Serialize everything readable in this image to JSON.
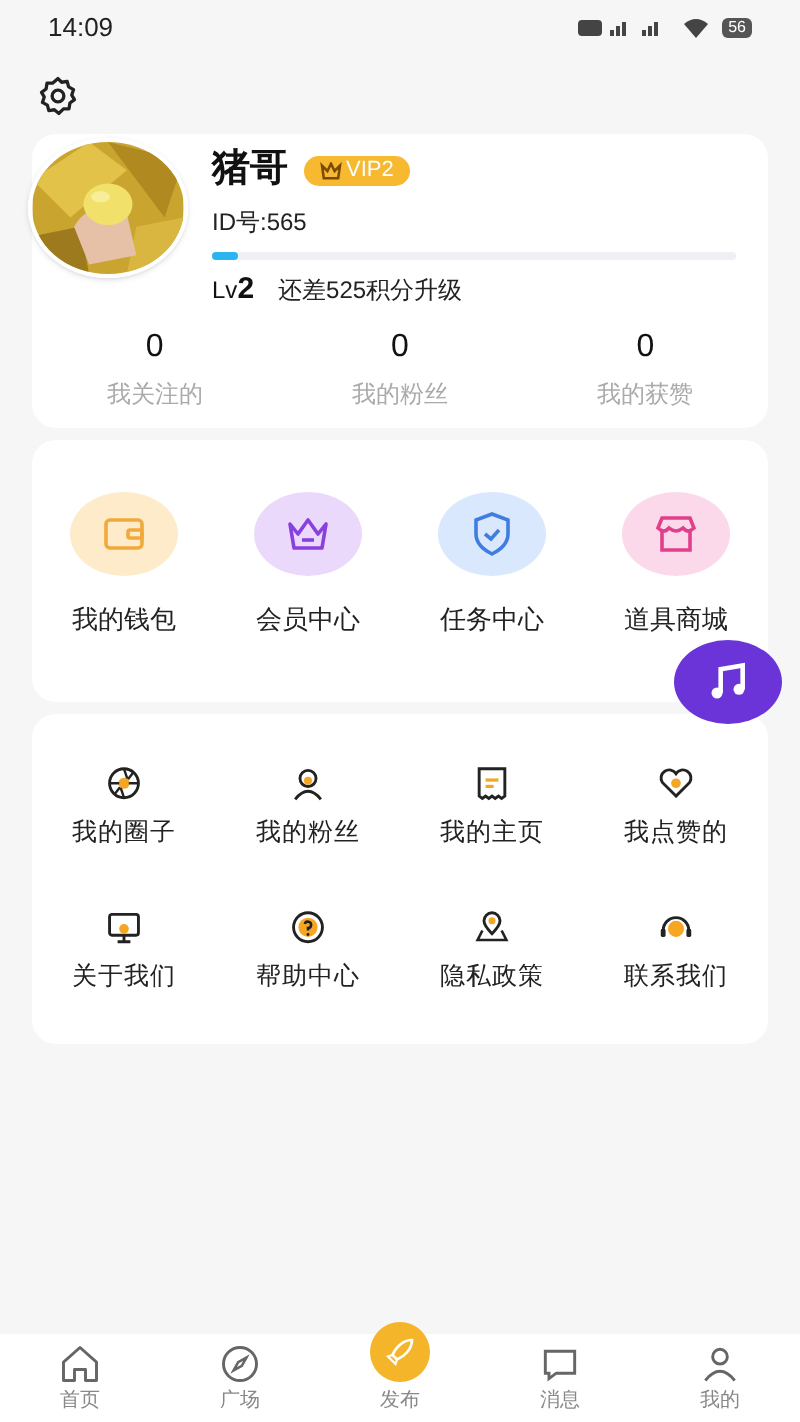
{
  "status_bar": {
    "time": "14:09",
    "battery": "56"
  },
  "profile": {
    "name": "猪哥",
    "vip": "VIP2",
    "id": "ID号:565",
    "level_label": "Lv",
    "level": "2",
    "progress": {
      "level": 0.05
    },
    "upgrade_hint": "还差525积分升级"
  },
  "stats": [
    {
      "value": "0",
      "label": "我关注的"
    },
    {
      "value": "0",
      "label": "我的粉丝"
    },
    {
      "value": "0",
      "label": "我的获赞"
    }
  ],
  "features": [
    {
      "label": "我的钱包"
    },
    {
      "label": "会员中心"
    },
    {
      "label": "任务中心"
    },
    {
      "label": "道具商城"
    }
  ],
  "menu": [
    {
      "label": "我的圈子"
    },
    {
      "label": "我的粉丝"
    },
    {
      "label": "我的主页"
    },
    {
      "label": "我点赞的"
    },
    {
      "label": "关于我们"
    },
    {
      "label": "帮助中心"
    },
    {
      "label": "隐私政策"
    },
    {
      "label": "联系我们"
    }
  ],
  "bottom_nav": [
    {
      "label": "首页",
      "selected": false
    },
    {
      "label": "广场",
      "selected": false
    },
    {
      "label": "发布",
      "selected": false
    },
    {
      "label": "消息",
      "selected": false
    },
    {
      "label": "我的",
      "selected": false
    }
  ]
}
